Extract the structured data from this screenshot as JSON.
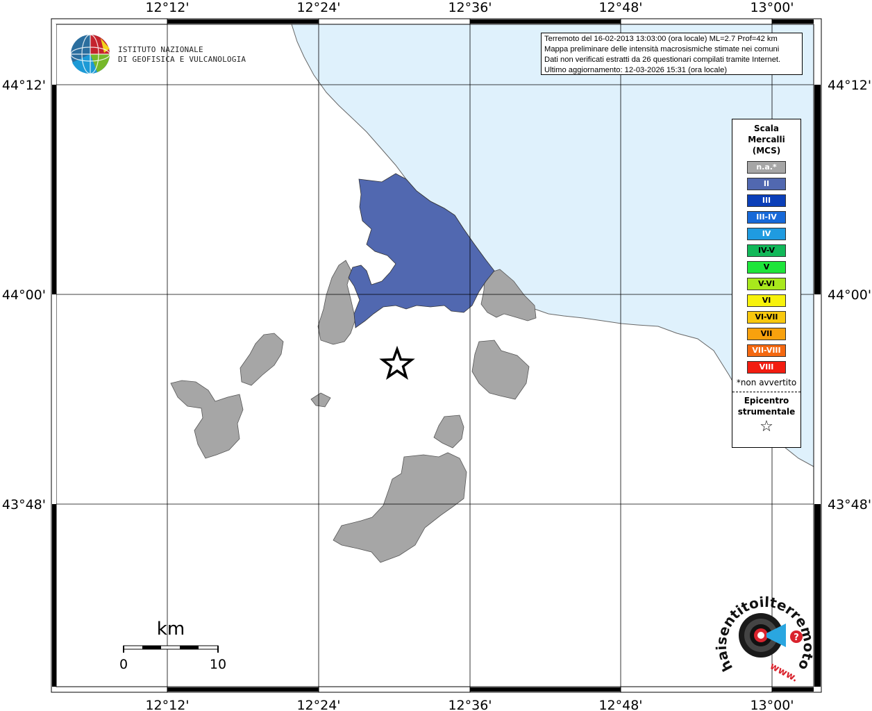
{
  "map": {
    "lon_ticks_top": [
      "12°12'",
      "12°24'",
      "12°36'",
      "12°48'",
      "13°00'"
    ],
    "lon_ticks_bottom": [
      "12°12'",
      "12°24'",
      "12°36'",
      "12°48'",
      "13°00'"
    ],
    "lat_ticks_left": [
      "44°12'",
      "44°00'",
      "43°48'"
    ],
    "lat_ticks_right": [
      "44°12'",
      "44°00'",
      "43°48'"
    ],
    "colors": {
      "sea": "#dff1fc",
      "na": "#a6a6a6",
      "intensity_II": "#5168b0",
      "grid": "#000000"
    },
    "epicenter_icon": "star-icon"
  },
  "logo_ingv": {
    "line1": "ISTITUTO NAZIONALE",
    "line2": "DI GEOFISICA E VULCANOLOGIA"
  },
  "info": {
    "line1": "Terremoto del 16-02-2013 13:03:00 (ora locale) ML=2.7 Prof=42 km",
    "line2": "Mappa preliminare delle intensità macrosismiche stimate nei comuni",
    "line3": "Dati non verificati estratti da 26 questionari compilati tramite Internet.",
    "line4": "Ultimo aggiornamento: 12-03-2026 15:31 (ora locale)"
  },
  "legend": {
    "title1": "Scala",
    "title2": "Mercalli",
    "title3": "(MCS)",
    "items": [
      {
        "label": "n.a.*",
        "color": "#a6a6a6",
        "text_color": "#ffffff"
      },
      {
        "label": "II",
        "color": "#5168b0",
        "text_color": "#ffffff"
      },
      {
        "label": "III",
        "color": "#0b3fb8",
        "text_color": "#ffffff"
      },
      {
        "label": "III-IV",
        "color": "#1769d8",
        "text_color": "#ffffff"
      },
      {
        "label": "IV",
        "color": "#1f9be0",
        "text_color": "#ffffff"
      },
      {
        "label": "IV-V",
        "color": "#11b859",
        "text_color": "#000000"
      },
      {
        "label": "V",
        "color": "#1ee53a",
        "text_color": "#000000"
      },
      {
        "label": "V-VI",
        "color": "#a8e81c",
        "text_color": "#000000"
      },
      {
        "label": "VI",
        "color": "#f7f20c",
        "text_color": "#000000"
      },
      {
        "label": "VI-VII",
        "color": "#f8c80e",
        "text_color": "#000000"
      },
      {
        "label": "VII",
        "color": "#f8a10d",
        "text_color": "#000000"
      },
      {
        "label": "VII-VIII",
        "color": "#f46810",
        "text_color": "#ffffff"
      },
      {
        "label": "VIII",
        "color": "#f21c10",
        "text_color": "#ffffff"
      }
    ],
    "note": "*non avvertito",
    "epi1": "Epicentro",
    "epi2": "strumentale",
    "epi_icon": "star-icon"
  },
  "scalebar": {
    "unit": "km",
    "left_label": "0",
    "right_label": "10"
  },
  "logo_hsit": {
    "url_text": "haisentitoilterremoto.it",
    "prefix": "www."
  }
}
